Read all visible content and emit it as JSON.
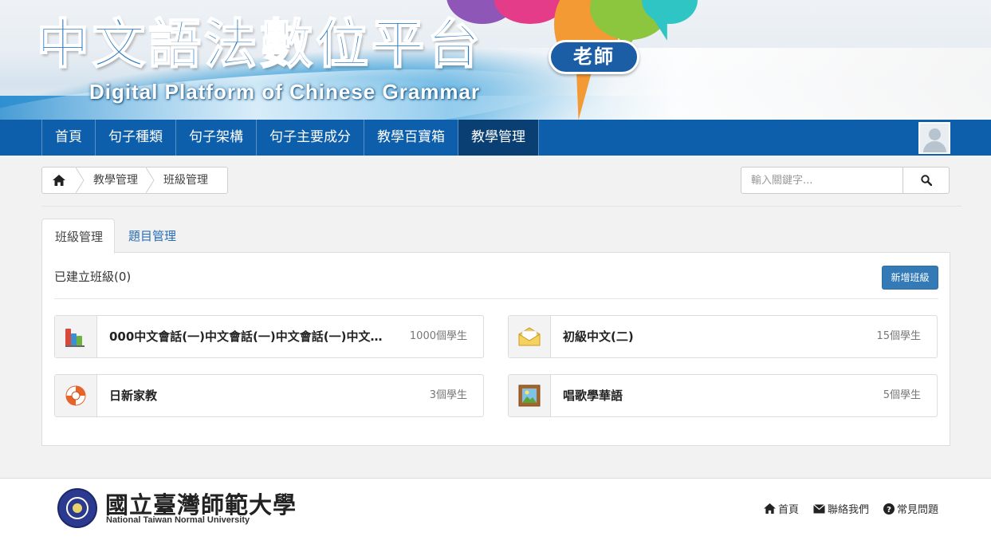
{
  "header": {
    "title": "中文語法數位平台",
    "subtitle": "Digital Platform of Chinese Grammar",
    "role_badge": "老師"
  },
  "nav": {
    "items": [
      {
        "label": "首頁",
        "active": false
      },
      {
        "label": "句子種類",
        "active": false
      },
      {
        "label": "句子架構",
        "active": false
      },
      {
        "label": "句子主要成分",
        "active": false
      },
      {
        "label": "教學百寶箱",
        "active": false
      },
      {
        "label": "教學管理",
        "active": true
      }
    ],
    "avatar_icon": "user-avatar-icon"
  },
  "breadcrumb": {
    "home_icon": "home-icon",
    "items": [
      "教學管理",
      "班級管理"
    ]
  },
  "search": {
    "placeholder": "輸入關鍵字...",
    "button_icon": "search-icon"
  },
  "tabs": [
    {
      "label": "班級管理",
      "active": true
    },
    {
      "label": "題目管理",
      "active": false
    }
  ],
  "panel": {
    "title": "已建立班級(0)",
    "add_button": "新增班級",
    "classes": [
      {
        "name": "000中文會話(一)中文會話(一)中文會話(一)中文會...",
        "students": "1000個學生",
        "icon": "bar-chart-icon"
      },
      {
        "name": "初級中文(二)",
        "students": "15個學生",
        "icon": "envelope-icon"
      },
      {
        "name": "日新家教",
        "students": "3個學生",
        "icon": "lifebuoy-icon"
      },
      {
        "name": "唱歌學華語",
        "students": "5個學生",
        "icon": "picture-frame-icon"
      }
    ]
  },
  "footer": {
    "university_zh": "國立臺灣師範大學",
    "university_en": "National Taiwan Normal University",
    "links": [
      {
        "label": "首頁",
        "icon": "home-icon"
      },
      {
        "label": "聯絡我們",
        "icon": "mail-icon"
      },
      {
        "label": "常見問題",
        "icon": "question-icon"
      }
    ]
  },
  "colors": {
    "nav_bg": "#0e5fab",
    "nav_active": "#0a3f73",
    "primary_button": "#337ab7",
    "link": "#2a6db5"
  }
}
